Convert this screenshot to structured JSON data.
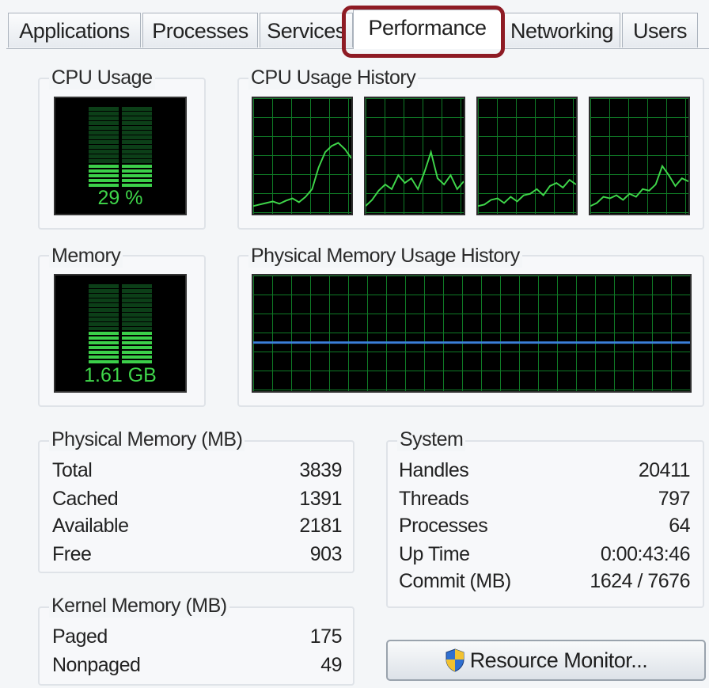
{
  "tabs": [
    {
      "label": "Applications"
    },
    {
      "label": "Processes"
    },
    {
      "label": "Services"
    },
    {
      "label": "Performance"
    },
    {
      "label": "Networking"
    },
    {
      "label": "Users"
    }
  ],
  "active_tab": "Performance",
  "cpu_usage": {
    "label": "CPU Usage",
    "value": "29 %",
    "level": 0.29
  },
  "cpu_history": {
    "label": "CPU Usage History",
    "cores": 4
  },
  "memory": {
    "label": "Memory",
    "value": "1.61 GB",
    "level": 0.42
  },
  "memory_history": {
    "label": "Physical Memory Usage History",
    "line_color": "#3b7fd9",
    "level": 0.42
  },
  "physical_memory": {
    "label": "Physical Memory (MB)",
    "rows": [
      {
        "key": "Total",
        "value": "3839"
      },
      {
        "key": "Cached",
        "value": "1391"
      },
      {
        "key": "Available",
        "value": "2181"
      },
      {
        "key": "Free",
        "value": "903"
      }
    ]
  },
  "kernel_memory": {
    "label": "Kernel Memory (MB)",
    "rows": [
      {
        "key": "Paged",
        "value": "175"
      },
      {
        "key": "Nonpaged",
        "value": "49"
      }
    ]
  },
  "system": {
    "label": "System",
    "rows": [
      {
        "key": "Handles",
        "value": "20411"
      },
      {
        "key": "Threads",
        "value": "797"
      },
      {
        "key": "Processes",
        "value": "64"
      },
      {
        "key": "Up Time",
        "value": "0:00:43:46"
      },
      {
        "key": "Commit (MB)",
        "value": "1624 / 7676"
      }
    ]
  },
  "resource_monitor_button": {
    "label": "Resource Monitor...",
    "icon": "uac-shield-icon"
  },
  "colors": {
    "graph_line": "#3fd64a",
    "grid": "#0f7a26",
    "highlight": "#8e1b24"
  }
}
